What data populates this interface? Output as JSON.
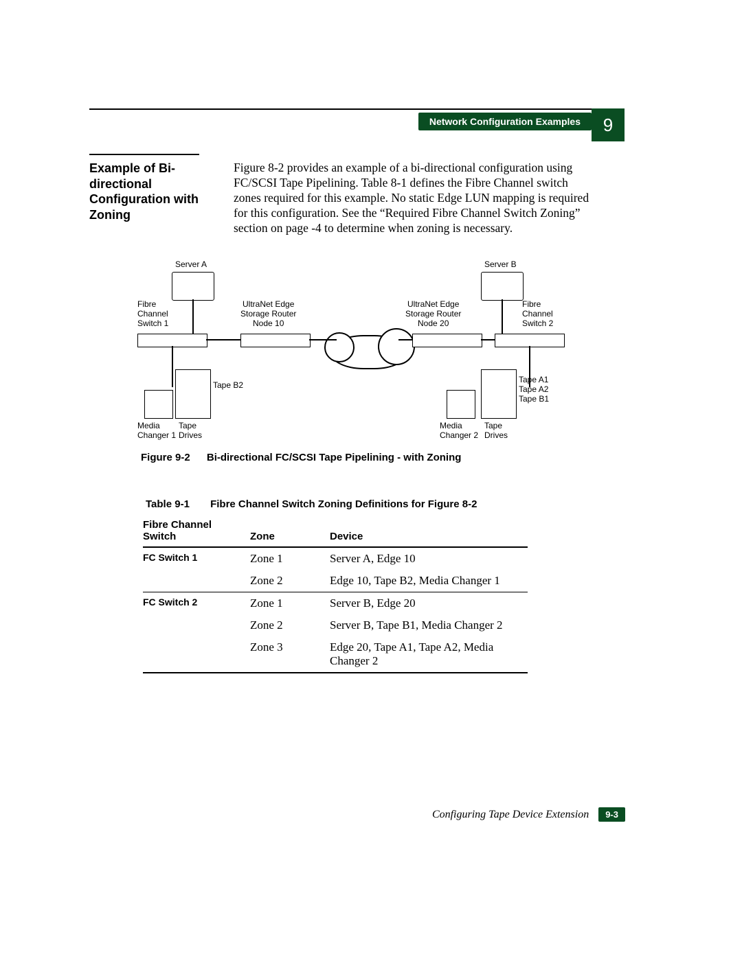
{
  "header": {
    "section_title": "Network Configuration Examples",
    "chapter_number": "9"
  },
  "section": {
    "heading": "Example of Bi-directional Configuration with Zoning",
    "body": "Figure 8-2 provides an example of a bi-directional configuration using FC/SCSI Tape Pipelining. Table 8-1 defines the Fibre Channel switch zones required for this example. No static Edge LUN mapping is required for this configuration. See the “Required Fibre Channel Switch Zoning” section on page -4 to determine when zoning is necessary."
  },
  "diagram": {
    "labels": {
      "server_a": "Server A",
      "server_b": "Server B",
      "fc_switch_1": "Fibre\nChannel\nSwitch 1",
      "fc_switch_2": "Fibre\nChannel\nSwitch 2",
      "router_node_10": "UltraNet Edge\nStorage Router\nNode 10",
      "router_node_20": "UltraNet Edge\nStorage Router\nNode 20",
      "media_changer_1": "Media\nChanger 1",
      "media_changer_2": "Media\nChanger 2",
      "tape_drives_left": "Tape\nDrives",
      "tape_drives_right": "Tape\nDrives",
      "tape_b2": "Tape B2",
      "tape_a1": "Tape A1",
      "tape_a2": "Tape A2",
      "tape_b1": "Tape B1"
    },
    "figure_label": "Figure 9-2",
    "figure_title": "Bi-directional FC/SCSI Tape Pipelining - with Zoning"
  },
  "table": {
    "label": "Table 9-1",
    "title": "Fibre Channel Switch Zoning Definitions for Figure 8-2",
    "headers": {
      "switch": "Fibre Channel Switch",
      "zone": "Zone",
      "device": "Device"
    },
    "rows": [
      {
        "switch": "FC Switch 1",
        "zone": "Zone 1",
        "device": "Server A, Edge 10"
      },
      {
        "switch": "",
        "zone": "Zone 2",
        "device": "Edge 10, Tape B2, Media Changer 1"
      },
      {
        "switch": "FC Switch 2",
        "zone": "Zone 1",
        "device": "Server B, Edge 20"
      },
      {
        "switch": "",
        "zone": "Zone 2",
        "device": "Server B, Tape B1, Media Changer 2"
      },
      {
        "switch": "",
        "zone": "Zone 3",
        "device": "Edge 20, Tape A1, Tape A2, Media Changer 2"
      }
    ]
  },
  "footer": {
    "doc_title": "Configuring Tape Device Extension",
    "page_number": "9-3"
  }
}
